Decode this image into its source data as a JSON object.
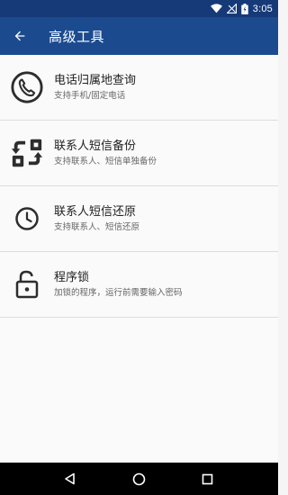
{
  "status": {
    "time": "3:05"
  },
  "app_bar": {
    "title": "高级工具",
    "back_icon": "arrow-back-icon"
  },
  "items": [
    {
      "title": "电话归属地查询",
      "subtitle": "支持手机/固定电话",
      "icon": "phone-icon"
    },
    {
      "title": "联系人短信备份",
      "subtitle": "支持联系人、短信单独备份",
      "icon": "backup-icon"
    },
    {
      "title": "联系人短信还原",
      "subtitle": "支持联系人、短信还原",
      "icon": "clock-icon"
    },
    {
      "title": "程序锁",
      "subtitle": "加锁的程序，运行前需要输入密码",
      "icon": "lock-open-icon"
    }
  ],
  "nav": {
    "back": "nav-back-icon",
    "home": "nav-home-icon",
    "recents": "nav-recents-icon"
  },
  "colors": {
    "status_bar": "#163a78",
    "app_bar": "#1b4a8f",
    "background": "#fafafa"
  }
}
